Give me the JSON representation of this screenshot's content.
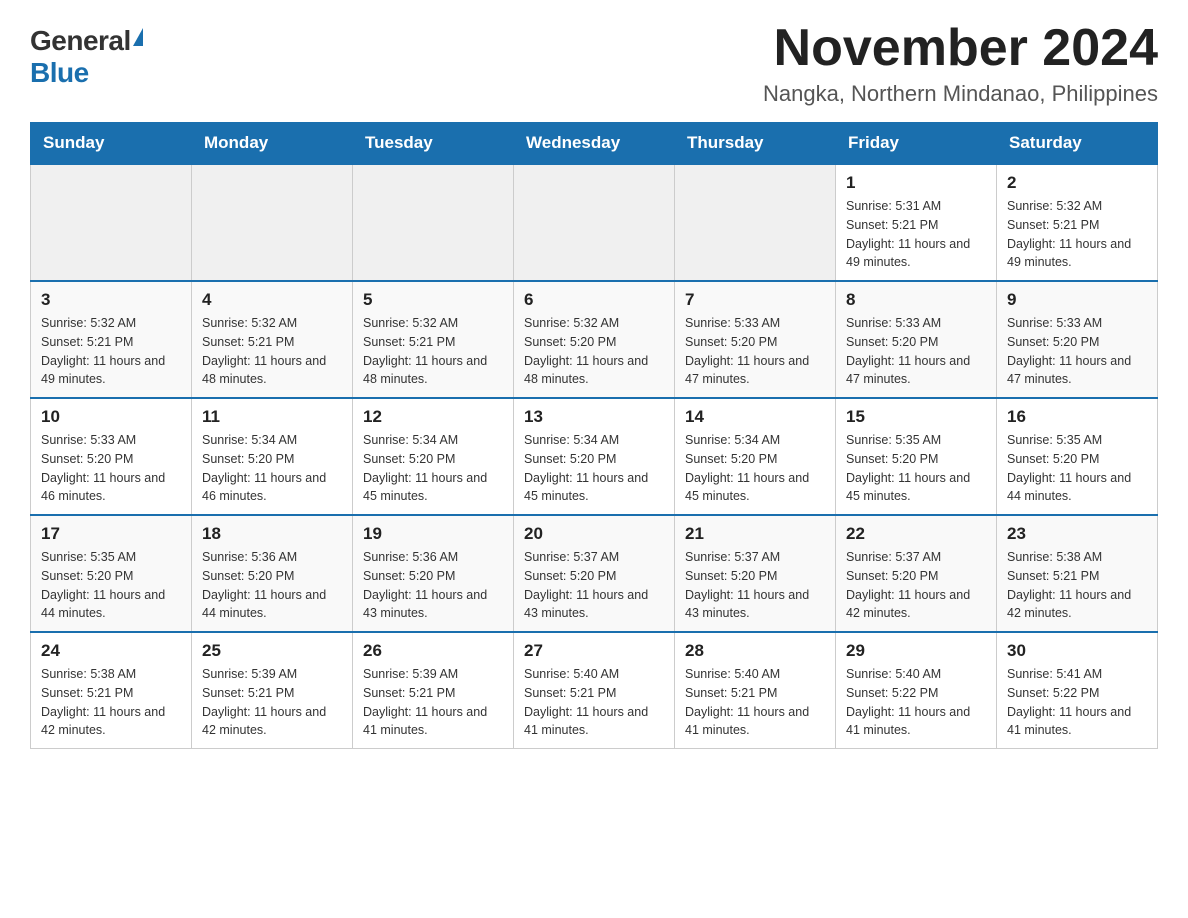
{
  "logo": {
    "general": "General",
    "blue": "Blue"
  },
  "title": "November 2024",
  "subtitle": "Nangka, Northern Mindanao, Philippines",
  "days_of_week": [
    "Sunday",
    "Monday",
    "Tuesday",
    "Wednesday",
    "Thursday",
    "Friday",
    "Saturday"
  ],
  "weeks": [
    [
      {
        "day": "",
        "info": ""
      },
      {
        "day": "",
        "info": ""
      },
      {
        "day": "",
        "info": ""
      },
      {
        "day": "",
        "info": ""
      },
      {
        "day": "",
        "info": ""
      },
      {
        "day": "1",
        "info": "Sunrise: 5:31 AM\nSunset: 5:21 PM\nDaylight: 11 hours and 49 minutes."
      },
      {
        "day": "2",
        "info": "Sunrise: 5:32 AM\nSunset: 5:21 PM\nDaylight: 11 hours and 49 minutes."
      }
    ],
    [
      {
        "day": "3",
        "info": "Sunrise: 5:32 AM\nSunset: 5:21 PM\nDaylight: 11 hours and 49 minutes."
      },
      {
        "day": "4",
        "info": "Sunrise: 5:32 AM\nSunset: 5:21 PM\nDaylight: 11 hours and 48 minutes."
      },
      {
        "day": "5",
        "info": "Sunrise: 5:32 AM\nSunset: 5:21 PM\nDaylight: 11 hours and 48 minutes."
      },
      {
        "day": "6",
        "info": "Sunrise: 5:32 AM\nSunset: 5:20 PM\nDaylight: 11 hours and 48 minutes."
      },
      {
        "day": "7",
        "info": "Sunrise: 5:33 AM\nSunset: 5:20 PM\nDaylight: 11 hours and 47 minutes."
      },
      {
        "day": "8",
        "info": "Sunrise: 5:33 AM\nSunset: 5:20 PM\nDaylight: 11 hours and 47 minutes."
      },
      {
        "day": "9",
        "info": "Sunrise: 5:33 AM\nSunset: 5:20 PM\nDaylight: 11 hours and 47 minutes."
      }
    ],
    [
      {
        "day": "10",
        "info": "Sunrise: 5:33 AM\nSunset: 5:20 PM\nDaylight: 11 hours and 46 minutes."
      },
      {
        "day": "11",
        "info": "Sunrise: 5:34 AM\nSunset: 5:20 PM\nDaylight: 11 hours and 46 minutes."
      },
      {
        "day": "12",
        "info": "Sunrise: 5:34 AM\nSunset: 5:20 PM\nDaylight: 11 hours and 45 minutes."
      },
      {
        "day": "13",
        "info": "Sunrise: 5:34 AM\nSunset: 5:20 PM\nDaylight: 11 hours and 45 minutes."
      },
      {
        "day": "14",
        "info": "Sunrise: 5:34 AM\nSunset: 5:20 PM\nDaylight: 11 hours and 45 minutes."
      },
      {
        "day": "15",
        "info": "Sunrise: 5:35 AM\nSunset: 5:20 PM\nDaylight: 11 hours and 45 minutes."
      },
      {
        "day": "16",
        "info": "Sunrise: 5:35 AM\nSunset: 5:20 PM\nDaylight: 11 hours and 44 minutes."
      }
    ],
    [
      {
        "day": "17",
        "info": "Sunrise: 5:35 AM\nSunset: 5:20 PM\nDaylight: 11 hours and 44 minutes."
      },
      {
        "day": "18",
        "info": "Sunrise: 5:36 AM\nSunset: 5:20 PM\nDaylight: 11 hours and 44 minutes."
      },
      {
        "day": "19",
        "info": "Sunrise: 5:36 AM\nSunset: 5:20 PM\nDaylight: 11 hours and 43 minutes."
      },
      {
        "day": "20",
        "info": "Sunrise: 5:37 AM\nSunset: 5:20 PM\nDaylight: 11 hours and 43 minutes."
      },
      {
        "day": "21",
        "info": "Sunrise: 5:37 AM\nSunset: 5:20 PM\nDaylight: 11 hours and 43 minutes."
      },
      {
        "day": "22",
        "info": "Sunrise: 5:37 AM\nSunset: 5:20 PM\nDaylight: 11 hours and 42 minutes."
      },
      {
        "day": "23",
        "info": "Sunrise: 5:38 AM\nSunset: 5:21 PM\nDaylight: 11 hours and 42 minutes."
      }
    ],
    [
      {
        "day": "24",
        "info": "Sunrise: 5:38 AM\nSunset: 5:21 PM\nDaylight: 11 hours and 42 minutes."
      },
      {
        "day": "25",
        "info": "Sunrise: 5:39 AM\nSunset: 5:21 PM\nDaylight: 11 hours and 42 minutes."
      },
      {
        "day": "26",
        "info": "Sunrise: 5:39 AM\nSunset: 5:21 PM\nDaylight: 11 hours and 41 minutes."
      },
      {
        "day": "27",
        "info": "Sunrise: 5:40 AM\nSunset: 5:21 PM\nDaylight: 11 hours and 41 minutes."
      },
      {
        "day": "28",
        "info": "Sunrise: 5:40 AM\nSunset: 5:21 PM\nDaylight: 11 hours and 41 minutes."
      },
      {
        "day": "29",
        "info": "Sunrise: 5:40 AM\nSunset: 5:22 PM\nDaylight: 11 hours and 41 minutes."
      },
      {
        "day": "30",
        "info": "Sunrise: 5:41 AM\nSunset: 5:22 PM\nDaylight: 11 hours and 41 minutes."
      }
    ]
  ]
}
